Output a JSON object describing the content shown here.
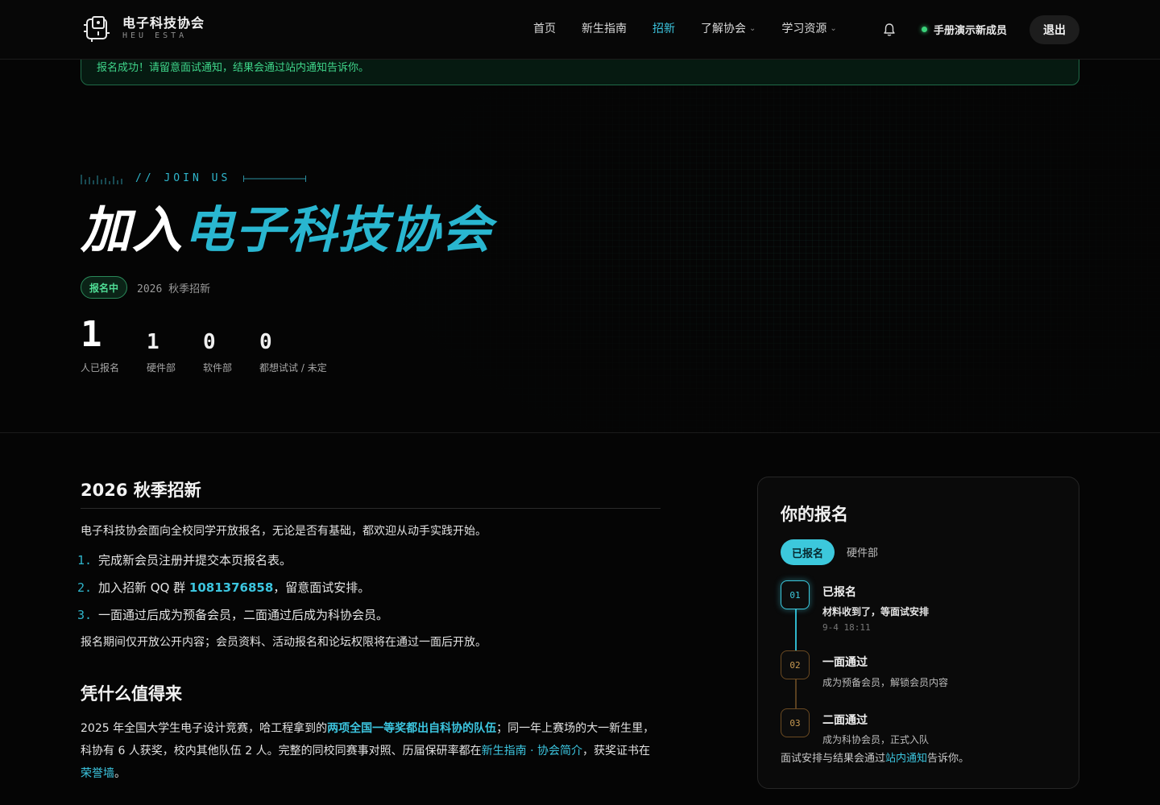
{
  "brand": {
    "name": "电子科技协会",
    "sub": "HEU ESTA"
  },
  "nav": [
    {
      "label": "首页",
      "dropdown": false,
      "active": false
    },
    {
      "label": "新生指南",
      "dropdown": false,
      "active": false
    },
    {
      "label": "招新",
      "dropdown": false,
      "active": true
    },
    {
      "label": "了解协会",
      "dropdown": true,
      "active": false
    },
    {
      "label": "学习资源",
      "dropdown": true,
      "active": false
    }
  ],
  "user": {
    "name": "手册演示新成员",
    "logout_label": "退出"
  },
  "banner": {
    "text": "报名成功！请留意面试通知，结果会通过站内通知告诉你。"
  },
  "hero": {
    "tag": "// JOIN US",
    "title_plain": "加入",
    "title_accent": "电子科技协会",
    "badge": "报名中",
    "term": "2026 秋季招新",
    "stats": [
      {
        "value": "1",
        "label": "人已报名"
      },
      {
        "value": "1",
        "label": "硬件部"
      },
      {
        "value": "0",
        "label": "软件部"
      },
      {
        "value": "0",
        "label": "都想试试 / 未定"
      }
    ]
  },
  "content": {
    "heading1": "2026 秋季招新",
    "intro": "电子科技协会面向全校同学开放报名，无论是否有基础，都欢迎从动手实践开始。",
    "steps": [
      {
        "num": "1.",
        "text": "完成新会员注册并提交本页报名表。"
      },
      {
        "num": "2.",
        "text_before": "加入招新 QQ 群 ",
        "qq": "1081376858",
        "text_after": "，留意面试安排。"
      },
      {
        "num": "3.",
        "text": "一面通过后成为预备会员，二面通过后成为科协会员。"
      }
    ],
    "notice": "报名期间仅开放公开内容；会员资料、活动报名和论坛权限将在通过一面后开放。",
    "heading2": "凭什么值得来",
    "why": {
      "part1": "2025 年全国大学生电子设计竞赛，哈工程拿到的",
      "highlight": "两项全国一等奖都出自科协的队伍",
      "part2": "；同一年上赛场的大一新生里，科协有 6 人获奖，校内其他队伍 2 人。完整的同校同赛事对照、历届保研率都在",
      "link1": "新生指南",
      "sep": " · ",
      "link2": "协会简介",
      "part3": "，获奖证书在",
      "link3": "荣誉墙",
      "part4": "。"
    }
  },
  "application": {
    "title": "你的报名",
    "status_pill": "已报名",
    "department": "硬件部",
    "steps": [
      {
        "index": "01",
        "title": "已报名",
        "desc": "材料收到了，等面试安排",
        "time": "9-4 18:11",
        "done": true
      },
      {
        "index": "02",
        "title": "一面通过",
        "desc": "成为预备会员，解锁会员内容",
        "done": false
      },
      {
        "index": "03",
        "title": "二面通过",
        "desc": "成为科协会员，正式入队",
        "done": false
      }
    ],
    "footer_before": "面试安排与结果会通过",
    "footer_link": "站内通知",
    "footer_after": "告诉你。"
  },
  "colors": {
    "accent": "#3cc5df",
    "success": "#3fd58a",
    "pending": "#c89a52"
  },
  "icons": {
    "logo": "circuit-logo-icon",
    "notification": "bell-icon",
    "dropdown": "chevron-down-icon"
  }
}
